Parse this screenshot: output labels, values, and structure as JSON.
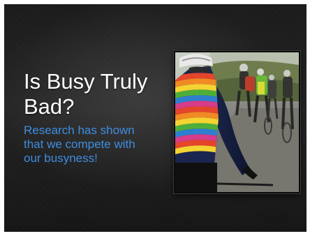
{
  "slide": {
    "title_line1": "Is Busy Truly",
    "title_line2": "Bad?",
    "body_line1": "Research has shown",
    "body_line2": "that we compete with",
    "body_line3": "our busyness!"
  },
  "photo": {
    "subject": "cyclists riding in a group on a road, rear view of rider in rainbow striped jersey"
  },
  "colors": {
    "background": "#222222",
    "title_text": "#ffffff",
    "body_text": "#3f8de0"
  }
}
